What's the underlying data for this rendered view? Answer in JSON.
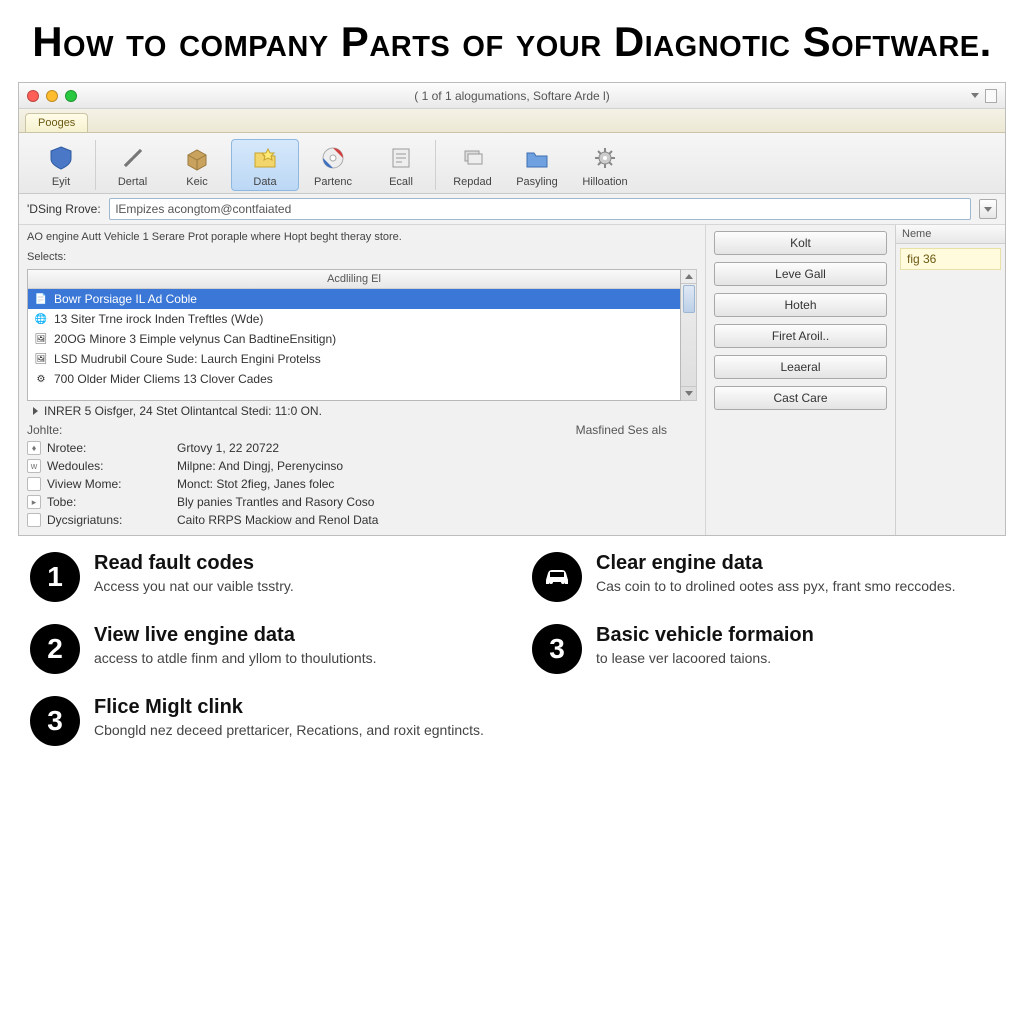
{
  "page_heading": "How to company Parts of your Diagnotic Software.",
  "window": {
    "title": "( 1 of 1 alogumations, Softare Arde l)",
    "tab_label": "Pooges",
    "toolbar": [
      {
        "label": "Eyit",
        "icon": "shield-icon"
      },
      {
        "label": "Dertal",
        "icon": "tools-icon"
      },
      {
        "label": "Keic",
        "icon": "box-icon"
      },
      {
        "label": "Data",
        "icon": "folder-star-icon",
        "selected": true
      },
      {
        "label": "Partenc",
        "icon": "disc-icon"
      },
      {
        "label": "Ecall",
        "icon": "note-icon"
      },
      {
        "label": "Repdad",
        "icon": "stack-icon"
      },
      {
        "label": "Pasyling",
        "icon": "folder-icon"
      },
      {
        "label": "Hilloation",
        "icon": "gear-icon"
      }
    ],
    "select_label": "'DSing Rrove:",
    "select_value": "lEmpizes acongtom@contfaiated",
    "description": "AO engine Autt Vehicle 1 Serare Prot poraple where Hopt beght theray store.",
    "list_subhead": "Selects:",
    "list_header": "Acdliling El",
    "list_items": [
      {
        "t": "Bowr Porsiage IL Ad Coble",
        "sel": true,
        "ico": "doc"
      },
      {
        "t": "13 Siter Trne irock Inden Treftles (Wde)",
        "ico": "globe"
      },
      {
        "t": "20OG Minore 3 Eimple velynus Can BadtineEnsitign)",
        "ico": "pic"
      },
      {
        "t": "LSD Mudrubil Coure Sude: Laurch Engini Protelss",
        "ico": "pic"
      },
      {
        "t": "700 Older Mider Cliems 13 Clover Cades",
        "ico": "gear"
      }
    ],
    "expand_row": "INRER 5 Oisfger, 24 Stet Olintantcal Stedi: 11:0 ON.",
    "section_left": "Johlte:",
    "section_right": "Masfined Ses als",
    "meta": [
      {
        "k": "Nrotee:",
        "v": "Grtovy 1, 22 20722",
        "ico": "i"
      },
      {
        "k": "Wedoules:",
        "v": "Milpne: And Dingj, Perenycinso",
        "ico": "w"
      },
      {
        "k": "Viview Mome:",
        "v": "Monct: Stot 2fieg, Janes folec",
        "ico": ""
      },
      {
        "k": "Tobe:",
        "v": "Bly panies Trantles and Rasory Coso",
        "ico": "d"
      },
      {
        "k": "Dycsigriatuns:",
        "v": "Caito RRPS Mackiow and Renol Data",
        "ico": ""
      }
    ],
    "buttons": [
      "Kolt",
      "Leve Gall",
      "Hoteh",
      "Firet Aroil..",
      "Leaeral",
      "Cast Care"
    ],
    "panel": {
      "header": "Neme",
      "item": "fig 36"
    }
  },
  "features": {
    "left": [
      {
        "n": "1",
        "title": "Read fault codes",
        "desc": "Access you nat our vaible tsstry."
      },
      {
        "n": "2",
        "title": "View live engine data",
        "desc": "access to atdle finm and yllom to thoulutionts."
      },
      {
        "n": "3",
        "title": "Flice Miglt clink",
        "desc": "Cbongld nez deceed prettaricer, Recations, and roxit egntincts."
      }
    ],
    "right": [
      {
        "n": "car",
        "title": "Clear engine data",
        "desc": "Cas coin to to drolined ootes ass pyx, frant smo reccodes."
      },
      {
        "n": "3",
        "title": "Basic vehicle formaion",
        "desc": "to lease ver lacoored taions."
      }
    ]
  }
}
